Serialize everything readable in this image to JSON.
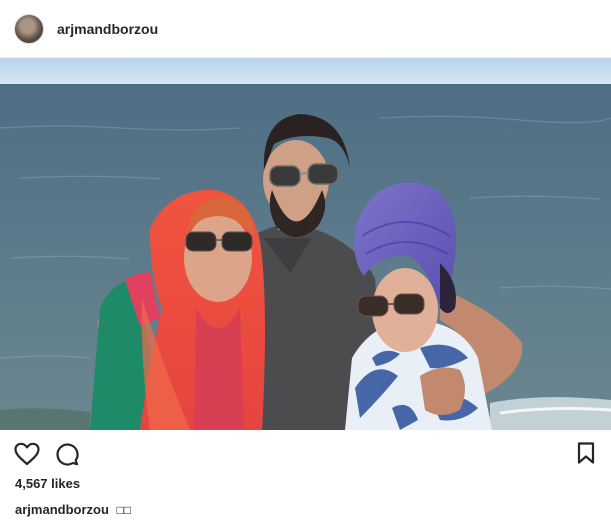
{
  "post": {
    "username": "arjmandborzou",
    "likes": "4,567 likes",
    "caption": {
      "username": "arjmandborzou",
      "text": "□□"
    }
  },
  "icons": {
    "like": "heart-outline-icon",
    "comment": "comment-bubble-icon",
    "save": "bookmark-outline-icon"
  },
  "colors": {
    "text": "#262626",
    "sea": "#5a7486",
    "sky": "#bcd6ea"
  }
}
